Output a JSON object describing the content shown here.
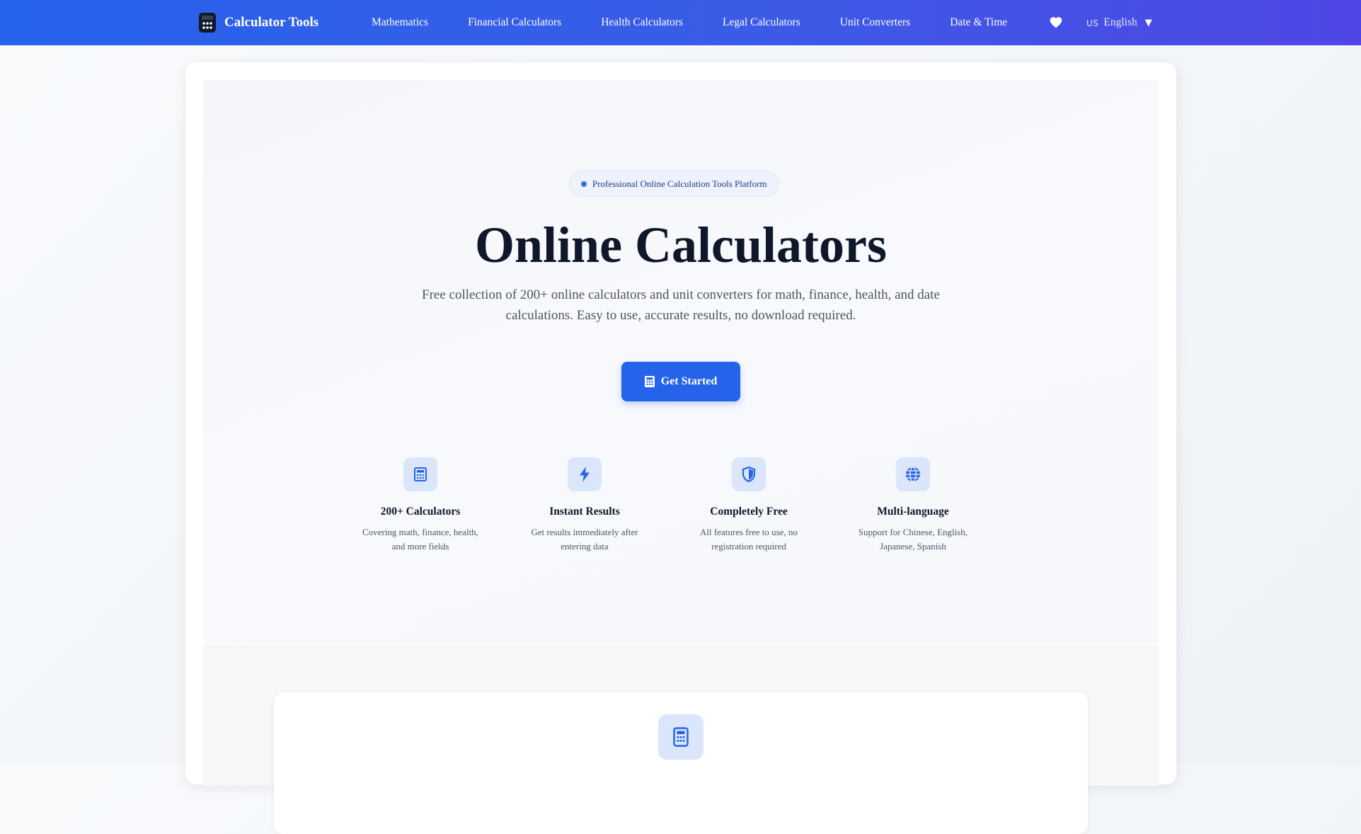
{
  "navbar": {
    "brand": {
      "icon": "calculator-icon",
      "label": "Calculator Tools"
    },
    "links": [
      {
        "label": "Mathematics"
      },
      {
        "label": "Financial Calculators"
      },
      {
        "label": "Health Calculators"
      },
      {
        "label": "Legal Calculators"
      },
      {
        "label": "Unit Converters"
      },
      {
        "label": "Date & Time"
      }
    ],
    "favorites_icon": "heart-icon",
    "language": {
      "flag": "US",
      "label": "English",
      "caret_icon": "caret-down-icon"
    },
    "colors": {
      "gradient_start": "#2563eb",
      "gradient_end": "#4f46e5"
    }
  },
  "hero": {
    "badge": "Professional Online Calculation Tools Platform",
    "title": "Online Calculators",
    "subtitle": "Free collection of 200+ online calculators and unit converters for math, finance, health, and date calculations. Easy to use, accurate results, no download required.",
    "cta": {
      "label": "Get Started",
      "icon": "calculator-icon",
      "color": "#2563eb"
    }
  },
  "features": [
    {
      "icon": "calculator-icon",
      "title": "200+ Calculators",
      "description": "Covering math, finance, health, and more fields"
    },
    {
      "icon": "bolt-icon",
      "title": "Instant Results",
      "description": "Get results immediately after entering data"
    },
    {
      "icon": "shield-icon",
      "title": "Completely Free",
      "description": "All features free to use, no registration required"
    },
    {
      "icon": "globe-icon",
      "title": "Multi-language",
      "description": "Support for Chinese, English, Japanese, Spanish"
    }
  ],
  "section2": {
    "icon": "calculator-icon"
  }
}
